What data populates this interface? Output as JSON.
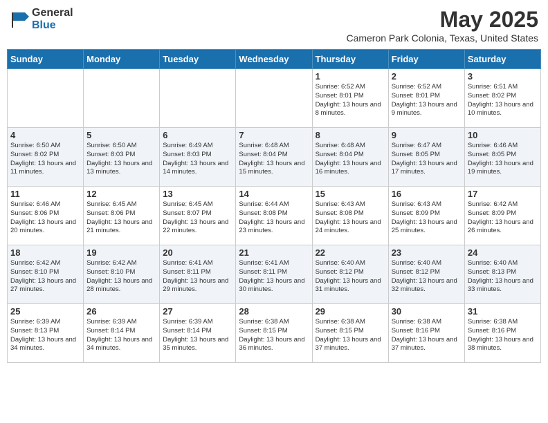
{
  "header": {
    "logo_general": "General",
    "logo_blue": "Blue",
    "month_title": "May 2025",
    "location": "Cameron Park Colonia, Texas, United States"
  },
  "weekdays": [
    "Sunday",
    "Monday",
    "Tuesday",
    "Wednesday",
    "Thursday",
    "Friday",
    "Saturday"
  ],
  "weeks": [
    [
      {
        "day": "",
        "info": ""
      },
      {
        "day": "",
        "info": ""
      },
      {
        "day": "",
        "info": ""
      },
      {
        "day": "",
        "info": ""
      },
      {
        "day": "1",
        "info": "Sunrise: 6:52 AM\nSunset: 8:01 PM\nDaylight: 13 hours and 8 minutes."
      },
      {
        "day": "2",
        "info": "Sunrise: 6:52 AM\nSunset: 8:01 PM\nDaylight: 13 hours and 9 minutes."
      },
      {
        "day": "3",
        "info": "Sunrise: 6:51 AM\nSunset: 8:02 PM\nDaylight: 13 hours and 10 minutes."
      }
    ],
    [
      {
        "day": "4",
        "info": "Sunrise: 6:50 AM\nSunset: 8:02 PM\nDaylight: 13 hours and 11 minutes."
      },
      {
        "day": "5",
        "info": "Sunrise: 6:50 AM\nSunset: 8:03 PM\nDaylight: 13 hours and 13 minutes."
      },
      {
        "day": "6",
        "info": "Sunrise: 6:49 AM\nSunset: 8:03 PM\nDaylight: 13 hours and 14 minutes."
      },
      {
        "day": "7",
        "info": "Sunrise: 6:48 AM\nSunset: 8:04 PM\nDaylight: 13 hours and 15 minutes."
      },
      {
        "day": "8",
        "info": "Sunrise: 6:48 AM\nSunset: 8:04 PM\nDaylight: 13 hours and 16 minutes."
      },
      {
        "day": "9",
        "info": "Sunrise: 6:47 AM\nSunset: 8:05 PM\nDaylight: 13 hours and 17 minutes."
      },
      {
        "day": "10",
        "info": "Sunrise: 6:46 AM\nSunset: 8:05 PM\nDaylight: 13 hours and 19 minutes."
      }
    ],
    [
      {
        "day": "11",
        "info": "Sunrise: 6:46 AM\nSunset: 8:06 PM\nDaylight: 13 hours and 20 minutes."
      },
      {
        "day": "12",
        "info": "Sunrise: 6:45 AM\nSunset: 8:06 PM\nDaylight: 13 hours and 21 minutes."
      },
      {
        "day": "13",
        "info": "Sunrise: 6:45 AM\nSunset: 8:07 PM\nDaylight: 13 hours and 22 minutes."
      },
      {
        "day": "14",
        "info": "Sunrise: 6:44 AM\nSunset: 8:08 PM\nDaylight: 13 hours and 23 minutes."
      },
      {
        "day": "15",
        "info": "Sunrise: 6:43 AM\nSunset: 8:08 PM\nDaylight: 13 hours and 24 minutes."
      },
      {
        "day": "16",
        "info": "Sunrise: 6:43 AM\nSunset: 8:09 PM\nDaylight: 13 hours and 25 minutes."
      },
      {
        "day": "17",
        "info": "Sunrise: 6:42 AM\nSunset: 8:09 PM\nDaylight: 13 hours and 26 minutes."
      }
    ],
    [
      {
        "day": "18",
        "info": "Sunrise: 6:42 AM\nSunset: 8:10 PM\nDaylight: 13 hours and 27 minutes."
      },
      {
        "day": "19",
        "info": "Sunrise: 6:42 AM\nSunset: 8:10 PM\nDaylight: 13 hours and 28 minutes."
      },
      {
        "day": "20",
        "info": "Sunrise: 6:41 AM\nSunset: 8:11 PM\nDaylight: 13 hours and 29 minutes."
      },
      {
        "day": "21",
        "info": "Sunrise: 6:41 AM\nSunset: 8:11 PM\nDaylight: 13 hours and 30 minutes."
      },
      {
        "day": "22",
        "info": "Sunrise: 6:40 AM\nSunset: 8:12 PM\nDaylight: 13 hours and 31 minutes."
      },
      {
        "day": "23",
        "info": "Sunrise: 6:40 AM\nSunset: 8:12 PM\nDaylight: 13 hours and 32 minutes."
      },
      {
        "day": "24",
        "info": "Sunrise: 6:40 AM\nSunset: 8:13 PM\nDaylight: 13 hours and 33 minutes."
      }
    ],
    [
      {
        "day": "25",
        "info": "Sunrise: 6:39 AM\nSunset: 8:13 PM\nDaylight: 13 hours and 34 minutes."
      },
      {
        "day": "26",
        "info": "Sunrise: 6:39 AM\nSunset: 8:14 PM\nDaylight: 13 hours and 34 minutes."
      },
      {
        "day": "27",
        "info": "Sunrise: 6:39 AM\nSunset: 8:14 PM\nDaylight: 13 hours and 35 minutes."
      },
      {
        "day": "28",
        "info": "Sunrise: 6:38 AM\nSunset: 8:15 PM\nDaylight: 13 hours and 36 minutes."
      },
      {
        "day": "29",
        "info": "Sunrise: 6:38 AM\nSunset: 8:15 PM\nDaylight: 13 hours and 37 minutes."
      },
      {
        "day": "30",
        "info": "Sunrise: 6:38 AM\nSunset: 8:16 PM\nDaylight: 13 hours and 37 minutes."
      },
      {
        "day": "31",
        "info": "Sunrise: 6:38 AM\nSunset: 8:16 PM\nDaylight: 13 hours and 38 minutes."
      }
    ]
  ]
}
